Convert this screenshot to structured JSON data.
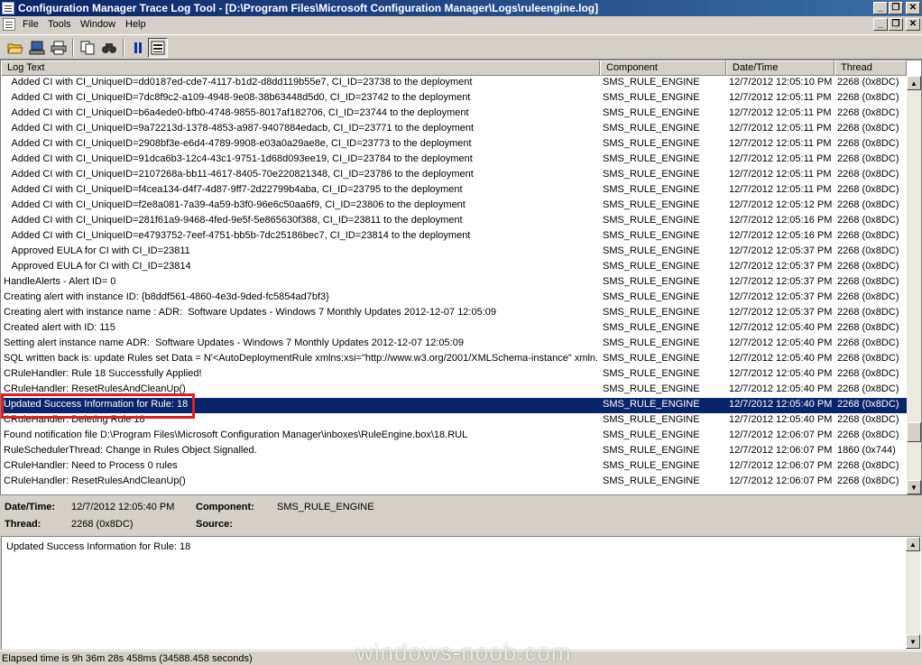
{
  "window": {
    "title": "Configuration Manager Trace Log Tool - [D:\\Program Files\\Microsoft Configuration Manager\\Logs\\ruleengine.log]"
  },
  "menu": [
    "File",
    "Tools",
    "Window",
    "Help"
  ],
  "toolbar_icons": [
    "open-folder-icon",
    "computer-icon",
    "print-icon",
    "copy-icon",
    "find-icon",
    "pause-icon",
    "highlight-icon"
  ],
  "columns": [
    "Log Text",
    "Component",
    "Date/Time",
    "Thread"
  ],
  "rows": [
    {
      "text": "   Added CI with CI_UniqueID=dd0187ed-cde7-4117-b1d2-d8dd119b55e7, CI_ID=23738 to the deployment",
      "component": "SMS_RULE_ENGINE",
      "datetime": "12/7/2012 12:05:10 PM",
      "thread": "2268 (0x8DC)"
    },
    {
      "text": "   Added CI with CI_UniqueID=7dc8f9c2-a109-4948-9e08-38b63448d5d0, CI_ID=23742 to the deployment",
      "component": "SMS_RULE_ENGINE",
      "datetime": "12/7/2012 12:05:11 PM",
      "thread": "2268 (0x8DC)"
    },
    {
      "text": "   Added CI with CI_UniqueID=b6a4ede0-bfb0-4748-9855-8017af182706, CI_ID=23744 to the deployment",
      "component": "SMS_RULE_ENGINE",
      "datetime": "12/7/2012 12:05:11 PM",
      "thread": "2268 (0x8DC)"
    },
    {
      "text": "   Added CI with CI_UniqueID=9a72213d-1378-4853-a987-9407884edacb, CI_ID=23771 to the deployment",
      "component": "SMS_RULE_ENGINE",
      "datetime": "12/7/2012 12:05:11 PM",
      "thread": "2268 (0x8DC)"
    },
    {
      "text": "   Added CI with CI_UniqueID=2908bf3e-e6d4-4789-9908-e03a0a29ae8e, CI_ID=23773 to the deployment",
      "component": "SMS_RULE_ENGINE",
      "datetime": "12/7/2012 12:05:11 PM",
      "thread": "2268 (0x8DC)"
    },
    {
      "text": "   Added CI with CI_UniqueID=91dca6b3-12c4-43c1-9751-1d68d093ee19, CI_ID=23784 to the deployment",
      "component": "SMS_RULE_ENGINE",
      "datetime": "12/7/2012 12:05:11 PM",
      "thread": "2268 (0x8DC)"
    },
    {
      "text": "   Added CI with CI_UniqueID=2107268a-bb11-4617-8405-70e220821348, CI_ID=23786 to the deployment",
      "component": "SMS_RULE_ENGINE",
      "datetime": "12/7/2012 12:05:11 PM",
      "thread": "2268 (0x8DC)"
    },
    {
      "text": "   Added CI with CI_UniqueID=f4cea134-d4f7-4d87-9ff7-2d22799b4aba, CI_ID=23795 to the deployment",
      "component": "SMS_RULE_ENGINE",
      "datetime": "12/7/2012 12:05:11 PM",
      "thread": "2268 (0x8DC)"
    },
    {
      "text": "   Added CI with CI_UniqueID=f2e8a081-7a39-4a59-b3f0-96e6c50aa6f9, CI_ID=23806 to the deployment",
      "component": "SMS_RULE_ENGINE",
      "datetime": "12/7/2012 12:05:12 PM",
      "thread": "2268 (0x8DC)"
    },
    {
      "text": "   Added CI with CI_UniqueID=281f61a9-9468-4fed-9e5f-5e865630f388, CI_ID=23811 to the deployment",
      "component": "SMS_RULE_ENGINE",
      "datetime": "12/7/2012 12:05:16 PM",
      "thread": "2268 (0x8DC)"
    },
    {
      "text": "   Added CI with CI_UniqueID=e4793752-7eef-4751-bb5b-7dc25186bec7, CI_ID=23814 to the deployment",
      "component": "SMS_RULE_ENGINE",
      "datetime": "12/7/2012 12:05:16 PM",
      "thread": "2268 (0x8DC)"
    },
    {
      "text": "   Approved EULA for CI with CI_ID=23811",
      "component": "SMS_RULE_ENGINE",
      "datetime": "12/7/2012 12:05:37 PM",
      "thread": "2268 (0x8DC)"
    },
    {
      "text": "   Approved EULA for CI with CI_ID=23814",
      "component": "SMS_RULE_ENGINE",
      "datetime": "12/7/2012 12:05:37 PM",
      "thread": "2268 (0x8DC)"
    },
    {
      "text": "HandleAlerts - Alert ID= 0",
      "component": "SMS_RULE_ENGINE",
      "datetime": "12/7/2012 12:05:37 PM",
      "thread": "2268 (0x8DC)"
    },
    {
      "text": "Creating alert with instance ID: {b8ddf561-4860-4e3d-9ded-fc5854ad7bf3}",
      "component": "SMS_RULE_ENGINE",
      "datetime": "12/7/2012 12:05:37 PM",
      "thread": "2268 (0x8DC)"
    },
    {
      "text": "Creating alert with instance name : ADR:  Software Updates - Windows 7 Monthly Updates 2012-12-07 12:05:09",
      "component": "SMS_RULE_ENGINE",
      "datetime": "12/7/2012 12:05:37 PM",
      "thread": "2268 (0x8DC)"
    },
    {
      "text": "Created alert with ID: 115",
      "component": "SMS_RULE_ENGINE",
      "datetime": "12/7/2012 12:05:40 PM",
      "thread": "2268 (0x8DC)"
    },
    {
      "text": "Setting alert instance name ADR:  Software Updates - Windows 7 Monthly Updates 2012-12-07 12:05:09",
      "component": "SMS_RULE_ENGINE",
      "datetime": "12/7/2012 12:05:40 PM",
      "thread": "2268 (0x8DC)"
    },
    {
      "text": "SQL written back is: update Rules set Data = N'<AutoDeploymentRule xmlns:xsi=\"http://www.w3.org/2001/XMLSchema-instance\" xmln...",
      "component": "SMS_RULE_ENGINE",
      "datetime": "12/7/2012 12:05:40 PM",
      "thread": "2268 (0x8DC)"
    },
    {
      "text": "CRuleHandler: Rule 18 Successfully Applied!",
      "component": "SMS_RULE_ENGINE",
      "datetime": "12/7/2012 12:05:40 PM",
      "thread": "2268 (0x8DC)"
    },
    {
      "text": "CRuleHandler: ResetRulesAndCleanUp()",
      "component": "SMS_RULE_ENGINE",
      "datetime": "12/7/2012 12:05:40 PM",
      "thread": "2268 (0x8DC)"
    },
    {
      "text": "Updated Success Information for Rule: 18",
      "component": "SMS_RULE_ENGINE",
      "datetime": "12/7/2012 12:05:40 PM",
      "thread": "2268 (0x8DC)",
      "selected": true
    },
    {
      "text": "CRuleHandler: Deleting Rule 18",
      "component": "SMS_RULE_ENGINE",
      "datetime": "12/7/2012 12:05:40 PM",
      "thread": "2268 (0x8DC)"
    },
    {
      "text": "Found notification file D:\\Program Files\\Microsoft Configuration Manager\\inboxes\\RuleEngine.box\\18.RUL",
      "component": "SMS_RULE_ENGINE",
      "datetime": "12/7/2012 12:06:07 PM",
      "thread": "2268 (0x8DC)"
    },
    {
      "text": "RuleSchedulerThread: Change in Rules Object Signalled.",
      "component": "SMS_RULE_ENGINE",
      "datetime": "12/7/2012 12:06:07 PM",
      "thread": "1860 (0x744)"
    },
    {
      "text": "CRuleHandler: Need to Process 0 rules",
      "component": "SMS_RULE_ENGINE",
      "datetime": "12/7/2012 12:06:07 PM",
      "thread": "2268 (0x8DC)"
    },
    {
      "text": "CRuleHandler: ResetRulesAndCleanUp()",
      "component": "SMS_RULE_ENGINE",
      "datetime": "12/7/2012 12:06:07 PM",
      "thread": "2268 (0x8DC)"
    }
  ],
  "details": {
    "datetime_label": "Date/Time:",
    "datetime_value": "12/7/2012 12:05:40 PM",
    "component_label": "Component:",
    "component_value": "SMS_RULE_ENGINE",
    "thread_label": "Thread:",
    "thread_value": "2268 (0x8DC)",
    "source_label": "Source:",
    "source_value": ""
  },
  "message": "Updated Success Information for Rule: 18",
  "status": "Elapsed time is 9h 36m 28s 458ms (34588.458 seconds)",
  "watermark": "windows-noob.com"
}
